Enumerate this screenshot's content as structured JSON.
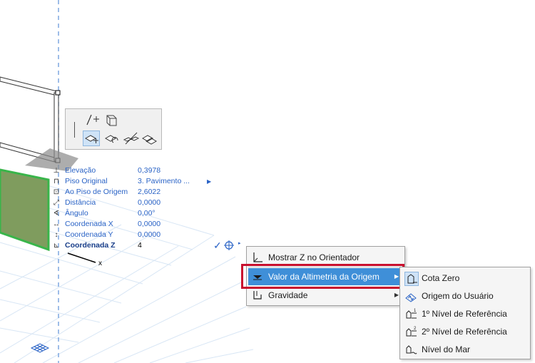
{
  "tracker": {
    "rows": [
      {
        "icon": "elevation-icon",
        "label": "Elevação",
        "value": "0,3978"
      },
      {
        "icon": "home-story-icon",
        "label": "Piso Original",
        "value": "3. Pavimento ..."
      },
      {
        "icon": "to-story-icon",
        "label": "Ao Piso de Origem",
        "value": "2,6022"
      },
      {
        "icon": "distance-icon",
        "label": "Distância",
        "value": "0,0000"
      },
      {
        "icon": "angle-icon",
        "label": "Ângulo",
        "value": "0,00°"
      },
      {
        "icon": "x-coordinate-icon",
        "label": "Coordenada X",
        "value": "0,0000"
      },
      {
        "icon": "y-coordinate-icon",
        "label": "Coordenada Y",
        "value": "0,0000"
      },
      {
        "icon": "z-coordinate-icon",
        "label": "Coordenada Z",
        "value": "4"
      }
    ]
  },
  "axis_label": "x",
  "context_menu": {
    "items": [
      {
        "label": "Mostrar Z no Orientador",
        "icon": "z-axis-icon"
      },
      {
        "label": "Valor da Altimetria da Origem",
        "icon": "origin-elevation-icon"
      },
      {
        "label": "Gravidade",
        "icon": "gravity-icon"
      }
    ]
  },
  "submenu": {
    "items": [
      {
        "label": "Cota Zero",
        "icon": "project-zero-icon"
      },
      {
        "label": "Origem do Usuário",
        "icon": "user-origin-icon"
      },
      {
        "label": "1º Nível de Referência",
        "icon": "reference-level-1-icon"
      },
      {
        "label": "2º Nível de Referência",
        "icon": "reference-level-2-icon"
      },
      {
        "label": "Nível do Mar",
        "icon": "sea-level-icon"
      }
    ]
  },
  "colors": {
    "accent": "#2a63c6",
    "highlight": "#3f8fd8",
    "annotation_red": "#c8102e",
    "wall_fill": "#7f9c5e",
    "wall_edge": "#39b54a"
  }
}
